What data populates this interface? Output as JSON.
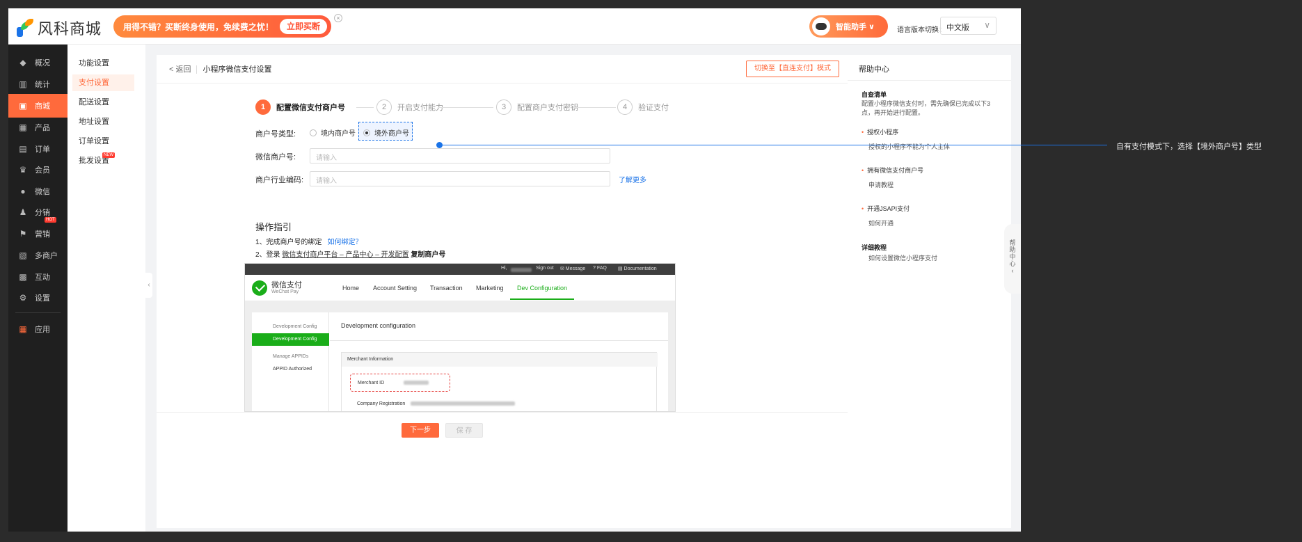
{
  "app": {
    "logo_text": "风科商城"
  },
  "banner": {
    "text": "用得不错？买断终身使用，免续费之忧！",
    "buy_label": "立即买断",
    "close": "×"
  },
  "header": {
    "assistant_label": "智能助手 ∨",
    "lang_label": "语言版本切换：",
    "lang_value": "中文版",
    "lang_chevron": "∨"
  },
  "nav": {
    "items": [
      {
        "label": "概况",
        "icon": "layers-icon",
        "glyph": "◆"
      },
      {
        "label": "统计",
        "icon": "chart-icon",
        "glyph": "▥"
      },
      {
        "label": "商城",
        "icon": "shop-icon",
        "glyph": "▣"
      },
      {
        "label": "产品",
        "icon": "grid-icon",
        "glyph": "▦"
      },
      {
        "label": "订单",
        "icon": "clipboard-icon",
        "glyph": "▤"
      },
      {
        "label": "会员",
        "icon": "crown-icon",
        "glyph": "♛"
      },
      {
        "label": "微信",
        "icon": "wechat-icon",
        "glyph": "●"
      },
      {
        "label": "分销",
        "icon": "user-share-icon",
        "glyph": "♟"
      },
      {
        "label": "营销",
        "icon": "flag-icon",
        "glyph": "⚑"
      },
      {
        "label": "多商户",
        "icon": "stores-icon",
        "glyph": "▧"
      },
      {
        "label": "互动",
        "icon": "interact-icon",
        "glyph": "▩"
      },
      {
        "label": "设置",
        "icon": "gear-icon",
        "glyph": "⚙"
      },
      {
        "label": "应用",
        "icon": "apps-icon",
        "glyph": "▦"
      }
    ],
    "hot_badge": "HOT"
  },
  "subnav": {
    "items": [
      "功能设置",
      "支付设置",
      "配送设置",
      "地址设置",
      "订单设置",
      "批发设置"
    ],
    "new_badge": "NEW"
  },
  "main": {
    "back_label": "< 返回",
    "title": "小程序微信支付设置",
    "switch_label": "切换至【直连支付】模式",
    "steps": [
      {
        "num": "1",
        "label": "配置微信支付商户号"
      },
      {
        "num": "2",
        "label": "开启支付能力"
      },
      {
        "num": "3",
        "label": "配置商户支付密钥"
      },
      {
        "num": "4",
        "label": "验证支付"
      }
    ],
    "form": {
      "type_label": "商户号类型:",
      "opt_domestic": "境内商户号",
      "opt_overseas": "境外商户号",
      "mchid_label": "微信商户号:",
      "mchid_placeholder": "请输入",
      "industry_label": "商户行业编码:",
      "industry_placeholder": "请输入",
      "learn_more": "了解更多"
    },
    "guide": {
      "title": "操作指引",
      "line1": "1、完成商户号的绑定",
      "line1_link": "如何绑定？",
      "line2_prefix": "2、登录",
      "line2_path": "微信支付商户平台 – 产品中心 – 开发配置",
      "line2_suffix": "复制商户号"
    },
    "next_label": "下一步",
    "save_label": "保 存"
  },
  "wxshot": {
    "top": {
      "hi": "Hi,",
      "signout": "Sign out",
      "message": "✉ Message",
      "faq": "? FAQ",
      "docs": "▤ Documentation"
    },
    "logo_cn": "微信支付",
    "logo_en": "WeChat Pay",
    "nav": [
      "Home",
      "Account Setting",
      "Transaction",
      "Marketing",
      "Dev Configuration"
    ],
    "side": [
      "Development Config",
      "Development Config",
      "Manage APPIDs",
      "APPID Authorized"
    ],
    "main_title": "Development configuration",
    "card_title": "Merchant Information",
    "merchant_id": "Merchant ID",
    "company_reg": "Company Registration"
  },
  "help": {
    "title": "帮助中心",
    "self_check": "自查清单",
    "self_check_desc": "配置小程序微信支付时，需先确保已完成以下3点，再开始进行配置。",
    "items": [
      {
        "title": "授权小程序",
        "desc": "授权的小程序不能为个人主体"
      },
      {
        "title": "拥有微信支付商户号",
        "desc": "申请教程"
      },
      {
        "title": "开通JSAPI支付",
        "desc": "如何开通"
      }
    ],
    "tutorial_title": "详细教程",
    "tutorial_link": "如何设置微信小程序支付",
    "float_label": "帮助中心 ‹"
  },
  "annotation": {
    "text": "自有支付模式下，选择【境外商户号】类型"
  },
  "colors": {
    "accent": "#ff6a3c",
    "annotation": "#1a73e8",
    "wechat_green": "#1aad19"
  }
}
